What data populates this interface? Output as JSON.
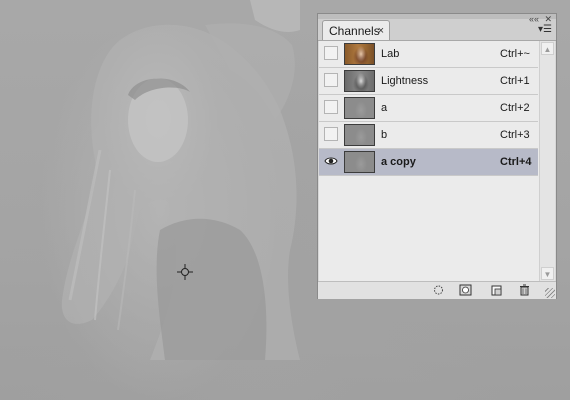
{
  "panel": {
    "tab_label": "Channels",
    "tab_close": "×",
    "collapse_glyph": "««",
    "close_glyph": "✕",
    "menu_glyph": "▾☰"
  },
  "channels": [
    {
      "name": "Lab",
      "shortcut": "Ctrl+~",
      "visible": false,
      "thumb": "color"
    },
    {
      "name": "Lightness",
      "shortcut": "Ctrl+1",
      "visible": false,
      "thumb": "grayscale"
    },
    {
      "name": "a",
      "shortcut": "Ctrl+2",
      "visible": false,
      "thumb": "flat-gray"
    },
    {
      "name": "b",
      "shortcut": "Ctrl+3",
      "visible": false,
      "thumb": "flat-gray"
    },
    {
      "name": "a copy",
      "shortcut": "Ctrl+4",
      "visible": true,
      "thumb": "flat-gray",
      "selected": true
    }
  ],
  "bottom_icons": [
    "load-selection-icon",
    "save-selection-icon",
    "new-channel-icon",
    "delete-channel-icon"
  ],
  "scroll_arrows": {
    "up": "▲",
    "down": "▼"
  },
  "colors": {
    "panel_bg": "#ebebeb",
    "selected_row": "#b7bac8",
    "canvas_gray": "#a8a8a8"
  }
}
